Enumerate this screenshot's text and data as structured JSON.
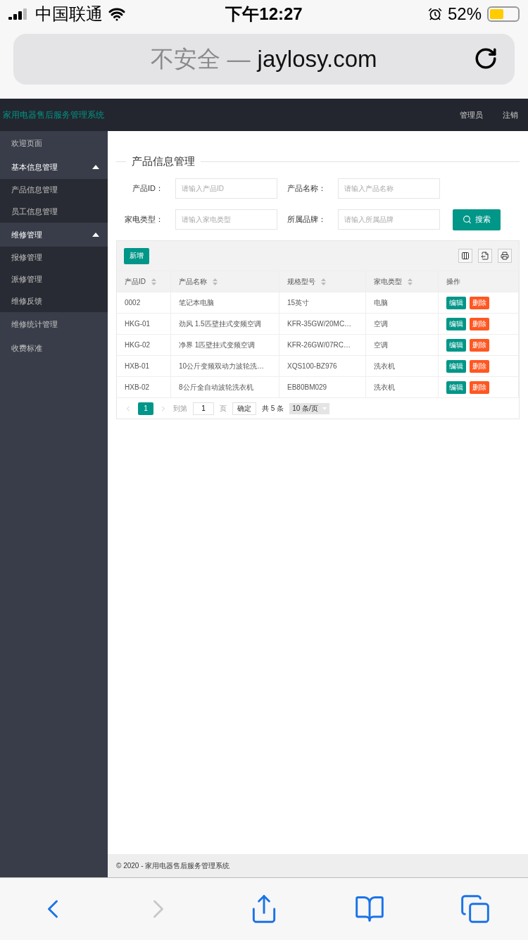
{
  "status_bar": {
    "carrier": "中国联通",
    "time": "下午12:27",
    "battery": "52%"
  },
  "address_bar": {
    "security": "不安全 —",
    "domain": "jaylosy.com"
  },
  "header": {
    "title": "家用电器售后服务管理系统",
    "links": [
      "管理员",
      "注销"
    ]
  },
  "sidebar": {
    "items": [
      {
        "kind": "link",
        "label": "欢迎页面"
      },
      {
        "kind": "group",
        "label": "基本信息管理",
        "expanded": true,
        "children": [
          {
            "label": "产品信息管理"
          },
          {
            "label": "员工信息管理"
          }
        ]
      },
      {
        "kind": "group",
        "label": "维修管理",
        "expanded": true,
        "children": [
          {
            "label": "报修管理"
          },
          {
            "label": "派修管理"
          },
          {
            "label": "维修反馈"
          }
        ]
      },
      {
        "kind": "link",
        "label": "维修统计管理"
      },
      {
        "kind": "link",
        "label": "收费标准"
      }
    ]
  },
  "panel": {
    "title": "产品信息管理",
    "filters": [
      {
        "label": "产品ID：",
        "placeholder": "请输入产品ID"
      },
      {
        "label": "产品名称：",
        "placeholder": "请输入产品名称"
      },
      {
        "label": "家电类型：",
        "placeholder": "请输入家电类型"
      },
      {
        "label": "所属品牌：",
        "placeholder": "请输入所属品牌"
      }
    ],
    "search_button": "搜索"
  },
  "table": {
    "add_button": "新增",
    "columns": [
      {
        "label": "产品ID",
        "sortable": true
      },
      {
        "label": "产品名称",
        "sortable": true
      },
      {
        "label": "规格型号",
        "sortable": true
      },
      {
        "label": "家电类型",
        "sortable": true
      },
      {
        "label": "操作",
        "sortable": false
      }
    ],
    "rows": [
      {
        "cells": [
          "0002",
          "笔记本电脑",
          "15英寸",
          "电脑"
        ],
        "actions": [
          "编辑",
          "删除"
        ]
      },
      {
        "cells": [
          "HKG-01",
          "劲风 1.5匹壁挂式变频空调",
          "KFR-35GW/20MC…",
          "空调"
        ],
        "actions": [
          "编辑",
          "删除"
        ]
      },
      {
        "cells": [
          "HKG-02",
          "净界 1匹壁挂式变频空调",
          "KFR-26GW/07RC…",
          "空调"
        ],
        "actions": [
          "编辑",
          "删除"
        ]
      },
      {
        "cells": [
          "HXB-01",
          "10公斤变频双动力波轮洗…",
          "XQS100-BZ976",
          "洗衣机"
        ],
        "actions": [
          "编辑",
          "删除"
        ]
      },
      {
        "cells": [
          "HXB-02",
          "8公斤全自动波轮洗衣机",
          "EB80BM029",
          "洗衣机"
        ],
        "actions": [
          "编辑",
          "删除"
        ]
      }
    ]
  },
  "pagination": {
    "prev_disabled": true,
    "next_disabled": true,
    "pages": [
      {
        "label": "1",
        "selected": true
      }
    ],
    "goto_label": "到第",
    "goto_value": "1",
    "page_unit": "页",
    "confirm": "确定",
    "total": "共 5 条",
    "page_size": "10 条/页"
  },
  "footer": "© 2020 - 家用电器售后服务管理系统",
  "browser_toolbar": [
    {
      "kind": "back",
      "disabled": false
    },
    {
      "kind": "forward",
      "disabled": true
    },
    {
      "kind": "share",
      "disabled": false
    },
    {
      "kind": "bookmarks",
      "disabled": false
    },
    {
      "kind": "tabs",
      "disabled": false
    }
  ]
}
